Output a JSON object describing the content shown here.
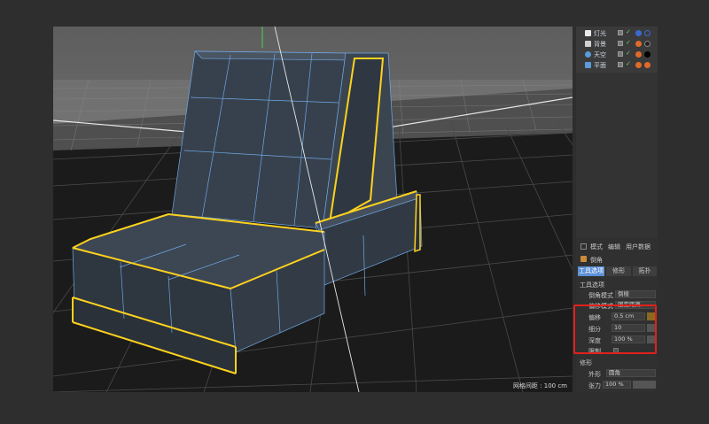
{
  "viewport": {
    "grid_label": "网格间距 : 100 cm"
  },
  "object_manager": {
    "items": [
      {
        "name": "灯光",
        "icon_color": "#e8e8e8",
        "tag_color": "#3a6ad0",
        "tag2_color": "#3a6ad0"
      },
      {
        "name": "背景",
        "icon_color": "#d0d0d0",
        "tag_color": "#e06a2a",
        "tag2_color": "#202020"
      },
      {
        "name": "天空",
        "icon_color": "#5a9ad8",
        "tag_color": "#e06a2a",
        "tag2_color": "#000000"
      },
      {
        "name": "平面",
        "icon_color": "#5a9ad8",
        "tag_color": "#e06a2a",
        "tag2_color": "#e06a2a"
      }
    ]
  },
  "attributes": {
    "menu": [
      "模式",
      "编辑",
      "用户数据"
    ],
    "object_title": "倒角",
    "tabs": [
      "工具选项",
      "修形",
      "拓扑"
    ],
    "section_tool": "工具选项",
    "bevel_mode_label": "倒角模式",
    "bevel_mode_value": "倒棱",
    "offset_mode_label": "偏移模式",
    "offset_mode_value": "固定距离",
    "offset_label": "偏移",
    "offset_value": "0.5 cm",
    "subdiv_label": "细分",
    "subdiv_value": "10",
    "depth_label": "深度",
    "depth_value": "100 %",
    "limit_label": "限制",
    "section_shape": "修形",
    "shape_label": "外形",
    "shape_value": "圆角",
    "tension_label": "张力",
    "tension_value": "100 %"
  },
  "colors": {
    "highlight": "#ffd21e",
    "wire": "#6fa8e6",
    "annotation": "#e0211d",
    "tab_active": "#5b8fd6"
  }
}
